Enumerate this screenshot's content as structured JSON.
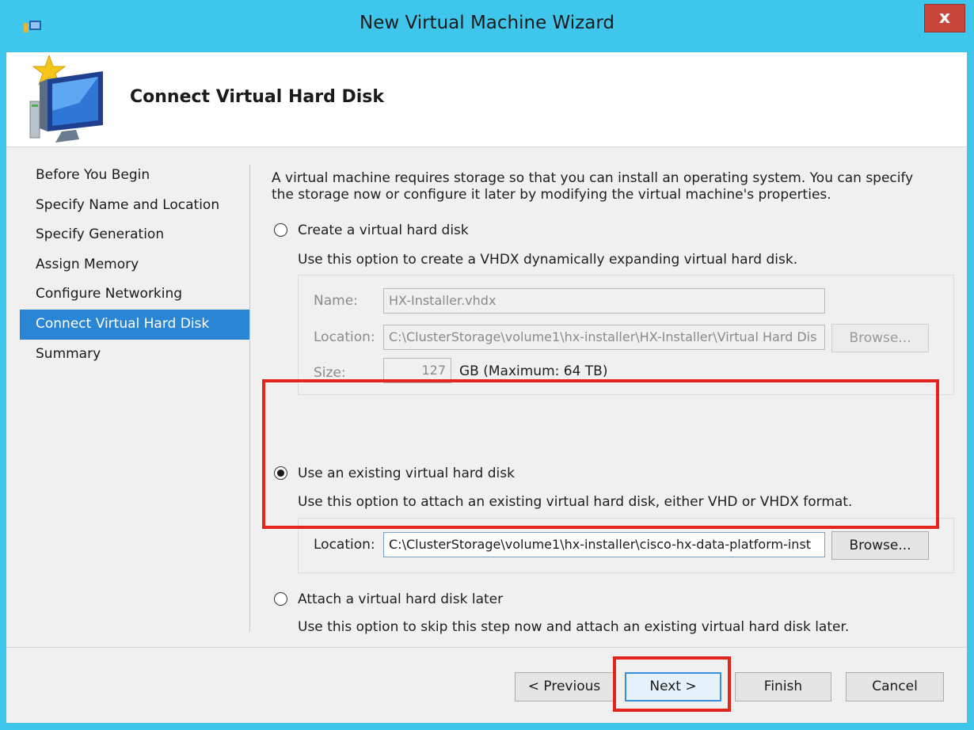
{
  "window": {
    "title": "New Virtual Machine Wizard",
    "close_glyph": "x"
  },
  "header": {
    "title": "Connect Virtual Hard Disk",
    "icon": "wizard-monitor-icon"
  },
  "nav": {
    "items": [
      {
        "label": "Before You Begin",
        "selected": false
      },
      {
        "label": "Specify Name and Location",
        "selected": false
      },
      {
        "label": "Specify Generation",
        "selected": false
      },
      {
        "label": "Assign Memory",
        "selected": false
      },
      {
        "label": "Configure Networking",
        "selected": false
      },
      {
        "label": "Connect Virtual Hard Disk",
        "selected": true
      },
      {
        "label": "Summary",
        "selected": false
      }
    ]
  },
  "content": {
    "intro": "A virtual machine requires storage so that you can install an operating system. You can specify the storage now or configure it later by modifying the virtual machine's properties.",
    "option_create": {
      "label": "Create a virtual hard disk",
      "description": "Use this option to create a VHDX dynamically expanding virtual hard disk.",
      "checked": false,
      "name_label": "Name:",
      "name_value": "HX-Installer.vhdx",
      "location_label": "Location:",
      "location_value": "C:\\ClusterStorage\\volume1\\hx-installer\\HX-Installer\\Virtual Hard Dis",
      "browse_label": "Browse...",
      "size_label": "Size:",
      "size_value": "127",
      "size_unit": "GB (Maximum: 64 TB)"
    },
    "option_existing": {
      "label": "Use an existing virtual hard disk",
      "description": "Use this option to attach an existing virtual hard disk, either VHD or VHDX format.",
      "checked": true,
      "location_label": "Location:",
      "location_value": "C:\\ClusterStorage\\volume1\\hx-installer\\cisco-hx-data-platform-inst",
      "browse_label": "Browse..."
    },
    "option_later": {
      "label": "Attach a virtual hard disk later",
      "description": "Use this option to skip this step now and attach an existing virtual hard disk later.",
      "checked": false
    }
  },
  "footer": {
    "previous_label": "< Previous",
    "next_label": "Next >",
    "finish_label": "Finish",
    "cancel_label": "Cancel"
  },
  "colors": {
    "accent": "#3fc6ec",
    "selection": "#2a86d4",
    "highlight": "#e3261c",
    "close": "#c9463d"
  }
}
